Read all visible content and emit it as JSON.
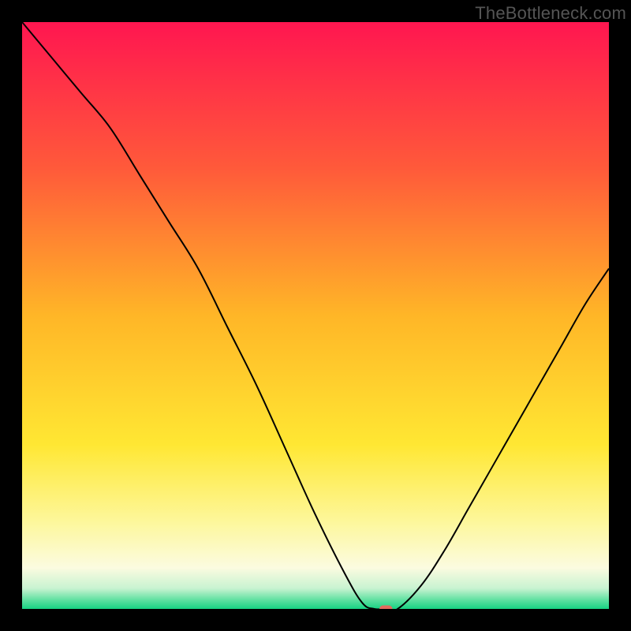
{
  "watermark": "TheBottleneck.com",
  "chart_data": {
    "type": "line",
    "title": "",
    "xlabel": "",
    "ylabel": "",
    "xlim": [
      0,
      100
    ],
    "ylim": [
      0,
      100
    ],
    "legend": null,
    "grid": false,
    "background": {
      "type": "vertical-gradient",
      "stops": [
        {
          "pos": 0.0,
          "color": "#ff1650"
        },
        {
          "pos": 0.25,
          "color": "#ff5a3a"
        },
        {
          "pos": 0.5,
          "color": "#ffb627"
        },
        {
          "pos": 0.72,
          "color": "#ffe733"
        },
        {
          "pos": 0.85,
          "color": "#fdf79a"
        },
        {
          "pos": 0.93,
          "color": "#fbfbe0"
        },
        {
          "pos": 0.965,
          "color": "#c8f3d1"
        },
        {
          "pos": 0.985,
          "color": "#5de0a0"
        },
        {
          "pos": 1.0,
          "color": "#17d282"
        }
      ]
    },
    "series": [
      {
        "name": "bottleneck-curve",
        "color": "#000000",
        "stroke_width": 2,
        "x": [
          0,
          5,
          10,
          15,
          20,
          25,
          30,
          35,
          40,
          45,
          50,
          55,
          58,
          60,
          62,
          64,
          68,
          72,
          76,
          80,
          84,
          88,
          92,
          96,
          100
        ],
        "y": [
          100,
          94,
          88,
          82,
          74,
          66,
          58,
          48,
          38,
          27,
          16,
          6,
          1,
          0,
          0,
          0,
          4,
          10,
          17,
          24,
          31,
          38,
          45,
          52,
          58
        ]
      }
    ],
    "marker": {
      "name": "optimal-point",
      "x": 62,
      "y": 0,
      "shape": "pill",
      "color": "#e36b5e",
      "width_pct": 2.2,
      "height_pct": 1.2
    }
  }
}
